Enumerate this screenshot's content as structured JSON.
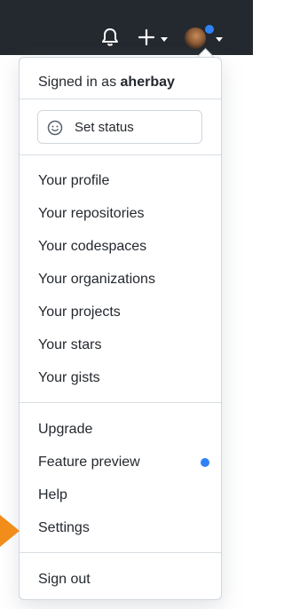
{
  "header": {
    "icons": [
      "bell-icon",
      "plus-icon",
      "chevron-down-icon",
      "avatar",
      "chevron-down-icon"
    ]
  },
  "menu": {
    "signed_in_prefix": "Signed in as",
    "username": "aherbay",
    "set_status_label": "Set status",
    "group1": [
      "Your profile",
      "Your repositories",
      "Your codespaces",
      "Your organizations",
      "Your projects",
      "Your stars",
      "Your gists"
    ],
    "group2": [
      "Upgrade",
      "Feature preview",
      "Help",
      "Settings"
    ],
    "sign_out": "Sign out"
  },
  "colors": {
    "topbar": "#24292f",
    "accent_dot": "#2f81f7",
    "pointer": "#f28c1b"
  }
}
